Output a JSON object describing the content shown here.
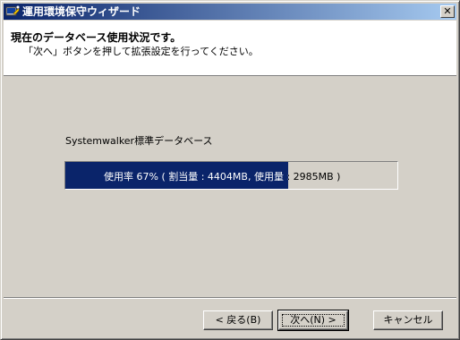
{
  "window": {
    "title": "運用環境保守ウィザード",
    "close_glyph": "✕"
  },
  "header": {
    "title": "現在のデータベース使用状況です。",
    "subtitle": "「次へ」ボタンを押して拡張設定を行ってください。"
  },
  "database": {
    "label": "Systemwalker標準データベース",
    "usage_percent": 67,
    "usage_text": "使用率  67% ( 割当量 : 4404MB, 使用量 : 2985MB )"
  },
  "buttons": {
    "back": "< 戻る(B)",
    "next": "次へ(N) >",
    "cancel": "キャンセル"
  },
  "colors": {
    "titlebar_start": "#0a246a",
    "titlebar_end": "#a6caf0",
    "progress_fill": "#0a246a",
    "dialog_face": "#d4d0c8"
  }
}
